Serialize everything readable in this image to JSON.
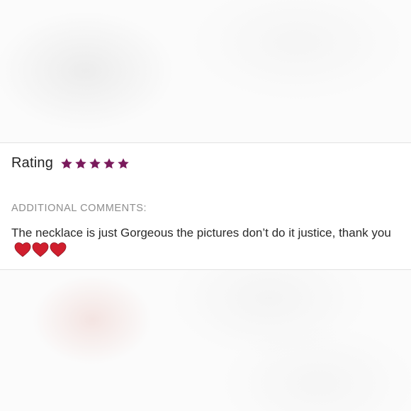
{
  "review": {
    "rating_label": "Rating",
    "rating_value": 5,
    "rating_max": 5,
    "star_color": "#7a1a5c",
    "comments_heading": "ADDITIONAL COMMENTS:",
    "comments_text": "The necklace is just Gorgeous the pictures don’t do it justice, thank you",
    "comment_emojis": [
      "heart-icon",
      "heart-icon",
      "heart-icon"
    ],
    "heart_color": "#d01f2e"
  }
}
